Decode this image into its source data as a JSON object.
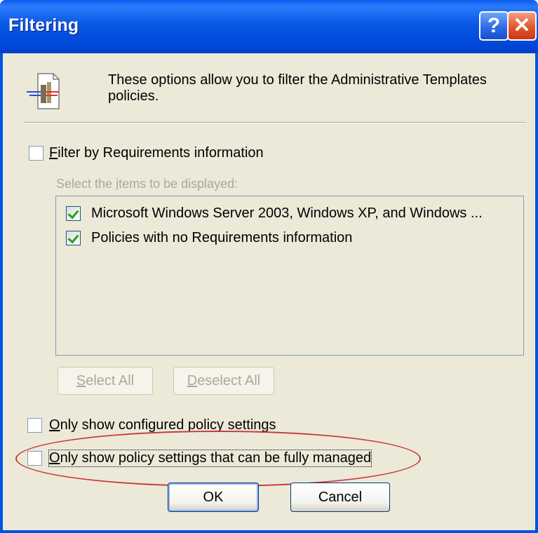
{
  "window": {
    "title": "Filtering",
    "help_glyph": "?",
    "close_glyph": "✕"
  },
  "header": {
    "icon": "filter-document-icon",
    "description": "These options allow you to filter the Administrative Templates policies."
  },
  "filter_requirements": {
    "label_prefix": "",
    "label_mnemonic": "F",
    "label_rest": "ilter by Requirements information",
    "checked": false
  },
  "items_section": {
    "label_prefix": "Select the ",
    "label_mnemonic": "i",
    "label_rest": "tems to be displayed:",
    "items": [
      {
        "label": "Microsoft Windows Server 2003, Windows XP, and Windows ...",
        "checked": true
      },
      {
        "label": "Policies with no Requirements information",
        "checked": true
      }
    ]
  },
  "buttons": {
    "select_all": {
      "mnemonic": "S",
      "rest": "elect All"
    },
    "deselect_all": {
      "mnemonic": "D",
      "rest": "eselect All"
    },
    "ok": "OK",
    "cancel": "Cancel"
  },
  "options": {
    "configured": {
      "mnemonic": "O",
      "rest": "nly show configured policy settings",
      "checked": false
    },
    "fully_managed": {
      "mnemonic": "O",
      "rest": "nly show policy settings that can be fully managed",
      "checked": false
    }
  },
  "colors": {
    "titlebar": "#0054E3",
    "face": "#ECE9D8",
    "annotation": "#C8373A",
    "checkmark": "#21A121"
  }
}
